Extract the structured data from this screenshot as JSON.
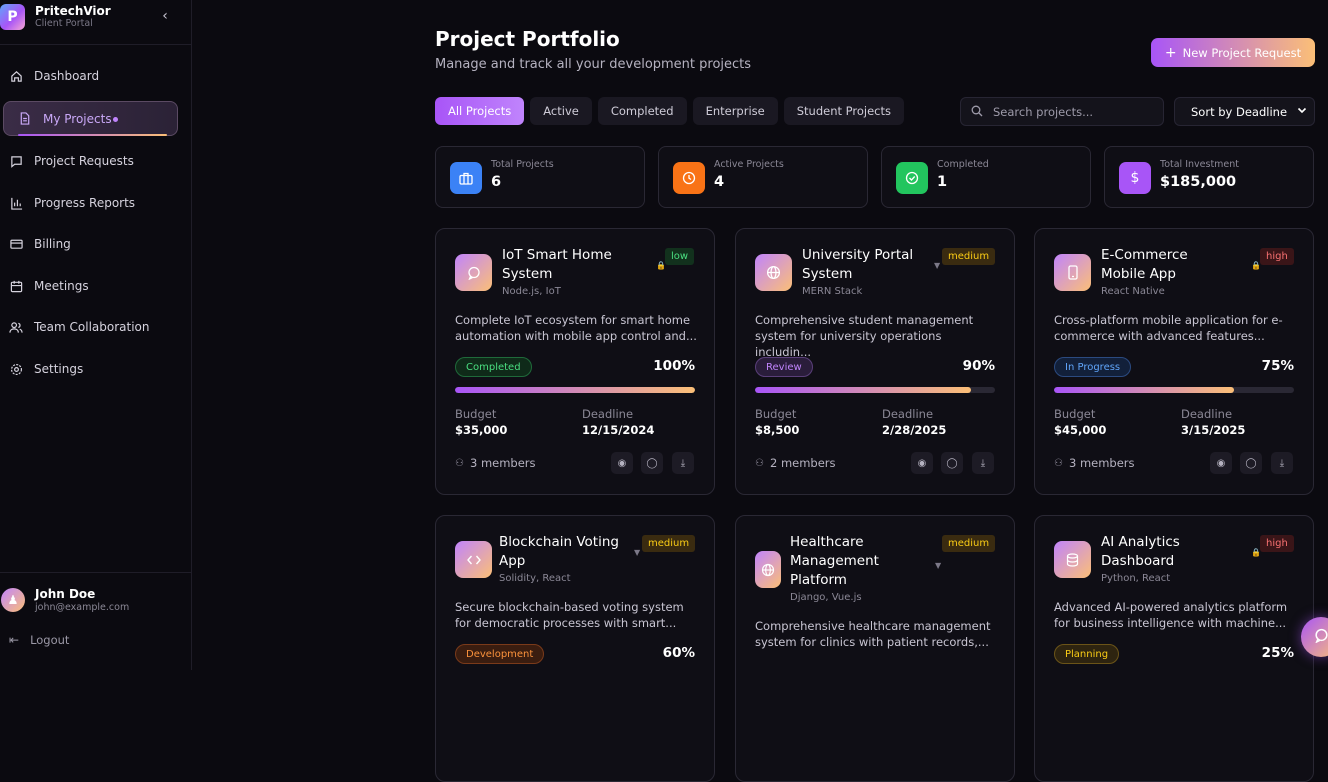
{
  "brand": {
    "name": "PritechVior",
    "sub": "Client Portal",
    "logo": "P"
  },
  "nav": [
    {
      "label": "Dashboard",
      "icon": "home-icon"
    },
    {
      "label": "My Projects",
      "icon": "document-icon"
    },
    {
      "label": "Project Requests",
      "icon": "chat-icon"
    },
    {
      "label": "Progress Reports",
      "icon": "bar-chart-icon"
    },
    {
      "label": "Billing",
      "icon": "credit-card-icon"
    },
    {
      "label": "Meetings",
      "icon": "calendar-icon"
    },
    {
      "label": "Team Collaboration",
      "icon": "users-icon"
    },
    {
      "label": "Settings",
      "icon": "gear-icon"
    }
  ],
  "user": {
    "name": "John Doe",
    "email": "john@example.com",
    "logout": "Logout"
  },
  "header": {
    "title": "Project Portfolio",
    "subtitle": "Manage and track all your development projects",
    "new_button": "New Project Request"
  },
  "tabs": [
    "All Projects",
    "Active",
    "Completed",
    "Enterprise",
    "Student Projects"
  ],
  "search": {
    "placeholder": "Search projects..."
  },
  "sort": {
    "label": "Sort by Deadline"
  },
  "stats": [
    {
      "label": "Total Projects",
      "value": "6",
      "color": "#3b82f6"
    },
    {
      "label": "Active Projects",
      "value": "4",
      "color": "#f97316"
    },
    {
      "label": "Completed",
      "value": "1",
      "color": "#22c55e"
    },
    {
      "label": "Total Investment",
      "value": "$185,000",
      "color": "#a855f7"
    }
  ],
  "labels": {
    "budget": "Budget",
    "deadline": "Deadline"
  },
  "projects": [
    {
      "title": "IoT Smart Home System",
      "tech": "Node.js, IoT",
      "priority": "low",
      "desc": "Complete IoT ecosystem for smart home automation with mobile app control and...",
      "status": "Completed",
      "progress": "100%",
      "budget": "$35,000",
      "deadline": "12/15/2024",
      "members": "3 members"
    },
    {
      "title": "University Portal System",
      "tech": "MERN Stack",
      "priority": "medium",
      "desc": "Comprehensive student management system for university operations includin...",
      "status": "Review",
      "progress": "90%",
      "budget": "$8,500",
      "deadline": "2/28/2025",
      "members": "2 members"
    },
    {
      "title": "E-Commerce Mobile App",
      "tech": "React Native",
      "priority": "high",
      "desc": "Cross-platform mobile application for e-commerce with advanced features...",
      "status": "In Progress",
      "progress": "75%",
      "budget": "$45,000",
      "deadline": "3/15/2025",
      "members": "3 members"
    },
    {
      "title": "Blockchain Voting App",
      "tech": "Solidity, React",
      "priority": "medium",
      "desc": "Secure blockchain-based voting system for democratic processes with smart...",
      "status": "Development",
      "progress": "60%"
    },
    {
      "title": "Healthcare Management Platform",
      "tech": "Django, Vue.js",
      "priority": "medium",
      "desc": "Comprehensive healthcare management system for clinics with patient records,..."
    },
    {
      "title": "AI Analytics Dashboard",
      "tech": "Python, React",
      "priority": "high",
      "desc": "Advanced AI-powered analytics platform for business intelligence with machine...",
      "status": "Planning",
      "progress": "25%"
    }
  ]
}
